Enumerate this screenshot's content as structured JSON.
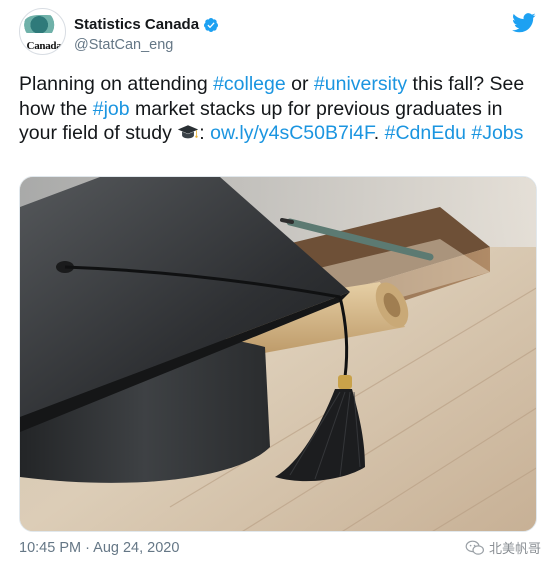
{
  "account": {
    "avatar_small_text": "Statistique\nCanada",
    "avatar_word": "Canada",
    "display_name": "Statistics Canada",
    "handle": "@StatCan_eng",
    "verified": true
  },
  "tweet": {
    "part1": "Planning on attending ",
    "tag_college": "#college",
    "part2": " or ",
    "tag_university": "#university",
    "part3": " this fall? See how the ",
    "tag_job": "#job",
    "part4": " market stacks up for previous graduates in your field of study ",
    "emoji": "graduation-cap",
    "part5": ": ",
    "link": "ow.ly/y4sC50B7i4F",
    "part6": ". ",
    "tag_cdnedu": "#CdnEdu",
    "part7": " ",
    "tag_jobs": "#Jobs"
  },
  "photo": {
    "subject": "graduation cap with diploma scroll and books on wooden table"
  },
  "footer": {
    "timestamp": "10:45 PM · Aug 24, 2020",
    "watermark": "北美帆哥"
  },
  "colors": {
    "link": "#1b95e0",
    "text": "#14171a",
    "secondary": "#657786",
    "twitter_blue": "#1da1f2"
  }
}
